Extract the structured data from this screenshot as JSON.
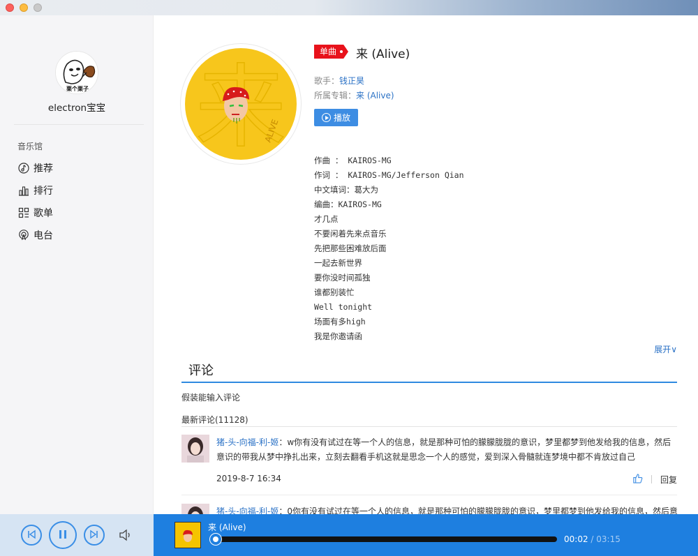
{
  "window": {
    "title": ""
  },
  "sidebar": {
    "username": "electron宝宝",
    "avatar_caption": "栗个栗子",
    "section_title": "音乐馆",
    "items": [
      {
        "label": "推荐",
        "icon": "music-note-icon"
      },
      {
        "label": "排行",
        "icon": "chart-bars-icon"
      },
      {
        "label": "歌单",
        "icon": "playlist-grid-icon"
      },
      {
        "label": "电台",
        "icon": "radio-icon"
      }
    ]
  },
  "song": {
    "badge": "单曲",
    "title": "来 (Alive)",
    "singer_label": "歌手：",
    "singer": "钱正昊",
    "album_label": "所属专辑：",
    "album": "来 (Alive)",
    "play_label": "播放",
    "cover_char": "来",
    "lyrics": [
      "作曲 ： KAIROS-MG",
      "作词 ： KAIROS-MG/Jefferson Qian",
      "中文填词：葛大为",
      "编曲：KAIROS-MG",
      "才几点",
      "不要闲着先来点音乐",
      "先把那些困难放后面",
      "一起去新世界",
      "要你没时间孤独",
      "谁都别装忙",
      "Well tonight",
      "场面有多high",
      "我是你邀请函"
    ],
    "expand_label": "展开∨"
  },
  "comments": {
    "heading": "评论",
    "input_placeholder": "假装能输入评论",
    "latest_label": "最新评论(11128)",
    "items": [
      {
        "user": "猪-头-向福-利-姬",
        "text": "：w你有没有试过在等一个人的信息，就是那种可怕的朦朦胧胧的意识，梦里都梦到他发给我的信息，然后意识的带我从梦中挣扎出来，立刻去翻看手机这就是思念一个人的感觉，爱到深入骨髓就连梦境中都不肯放过自己",
        "time": "2019-8-7 16:34",
        "reply": "回复"
      },
      {
        "user": "猪-头-向福-利-姬",
        "text": "：0你有没有试过在等一个人的信息，就是那种可怕的朦朦胧胧的意识，梦里都梦到他发给我的信息，然后意",
        "time": "",
        "reply": ""
      }
    ]
  },
  "player": {
    "now_playing": "来 (Alive)",
    "current_time": "00:02",
    "total_time": "/ 03:15",
    "progress": 0.01,
    "accent": "#1e7fe0"
  }
}
